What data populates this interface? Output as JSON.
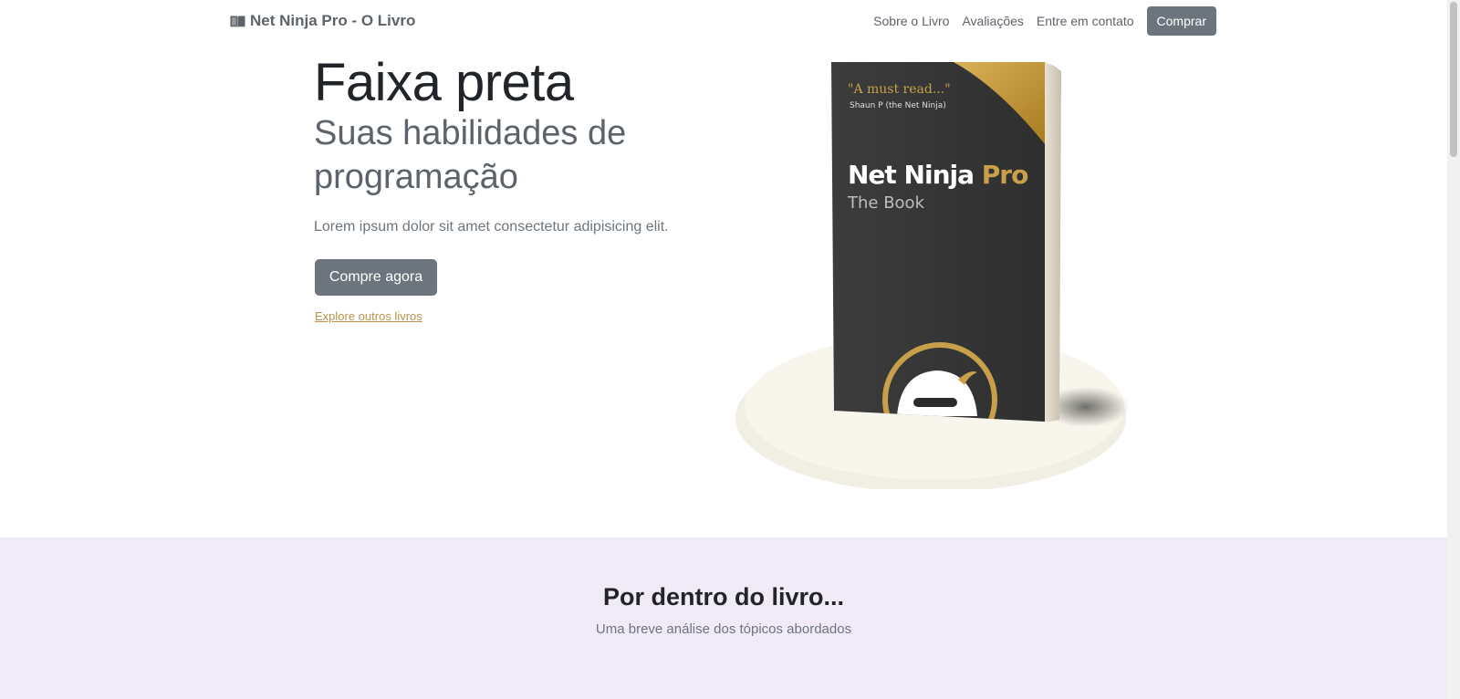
{
  "navbar": {
    "brand": "Net Ninja Pro - O Livro",
    "links": [
      "Sobre o Livro",
      "Avaliações",
      "Entre em contato"
    ],
    "cta": "Comprar"
  },
  "hero": {
    "title": "Faixa preta",
    "subtitle": "Suas habilidades de programação",
    "lead": "Lorem ipsum dolor sit amet consectetur adipisicing elit.",
    "buy_button": "Compre agora",
    "explore_link": "Explore outros livros"
  },
  "book": {
    "quote": "\"A must read...\"",
    "quote_author": "Shaun P (the Net Ninja)",
    "title_main": "Net Ninja",
    "title_accent": "Pro",
    "subtitle": "The Book"
  },
  "inside": {
    "title": "Por dentro do livro...",
    "subtitle": "Uma breve análise dos tópicos abordados"
  },
  "colors": {
    "primary": "#6c757d",
    "accent_gold": "#b8934a",
    "section_bg": "#f1eaf7",
    "book_dark": "#353535"
  }
}
